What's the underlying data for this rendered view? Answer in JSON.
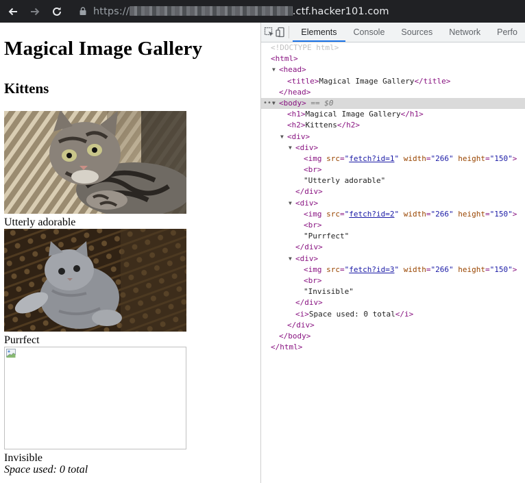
{
  "browser": {
    "url_scheme": "https://",
    "url_host": ".ctf.hacker101.com"
  },
  "page": {
    "heading": "Magical Image Gallery",
    "subheading": "Kittens",
    "images": [
      {
        "src": "fetch?id=1",
        "caption": "Utterly adorable",
        "broken": false
      },
      {
        "src": "fetch?id=2",
        "caption": "Purrfect",
        "broken": false
      },
      {
        "src": "fetch?id=3",
        "caption": "Invisible",
        "broken": true
      }
    ],
    "space_used": "Space used: 0 total"
  },
  "devtools": {
    "tabs": [
      "Elements",
      "Console",
      "Sources",
      "Network",
      "Perfo"
    ],
    "active_tab": "Elements",
    "selected_marker": "== $0",
    "dom": {
      "doctype": "<!DOCTYPE html>",
      "title_text": "Magical Image Gallery",
      "h1_text": "Magical Image Gallery",
      "h2_text": "Kittens",
      "img_width": "266",
      "img_height": "150",
      "texts": [
        "\"Utterly adorable\"",
        "\"Purrfect\"",
        "\"Invisible\""
      ],
      "i_text": "Space used: 0 total"
    }
  }
}
